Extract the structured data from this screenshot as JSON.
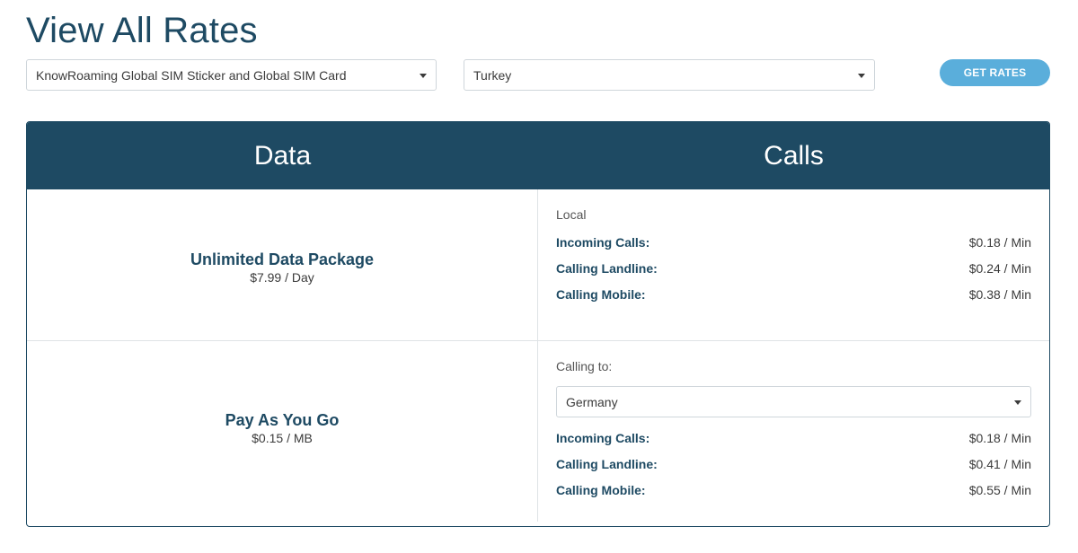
{
  "page_title": "View All Rates",
  "product_select": {
    "value": "KnowRoaming Global SIM Sticker and Global SIM Card"
  },
  "country_select": {
    "value": "Turkey"
  },
  "get_rates_label": "GET RATES",
  "header": {
    "data": "Data",
    "calls": "Calls"
  },
  "plans": [
    {
      "name": "Unlimited Data Package",
      "price": "$7.99 / Day"
    },
    {
      "name": "Pay As You Go",
      "price": "$0.15 / MB"
    }
  ],
  "local": {
    "label": "Local",
    "rates": [
      {
        "label": "Incoming Calls:",
        "value": "$0.18 / Min"
      },
      {
        "label": "Calling Landline:",
        "value": "$0.24 / Min"
      },
      {
        "label": "Calling Mobile:",
        "value": "$0.38 / Min"
      }
    ]
  },
  "calling_to": {
    "label": "Calling to:",
    "destination": "Germany",
    "rates": [
      {
        "label": "Incoming Calls:",
        "value": "$0.18 / Min"
      },
      {
        "label": "Calling Landline:",
        "value": "$0.41 / Min"
      },
      {
        "label": "Calling Mobile:",
        "value": "$0.55 / Min"
      }
    ]
  }
}
